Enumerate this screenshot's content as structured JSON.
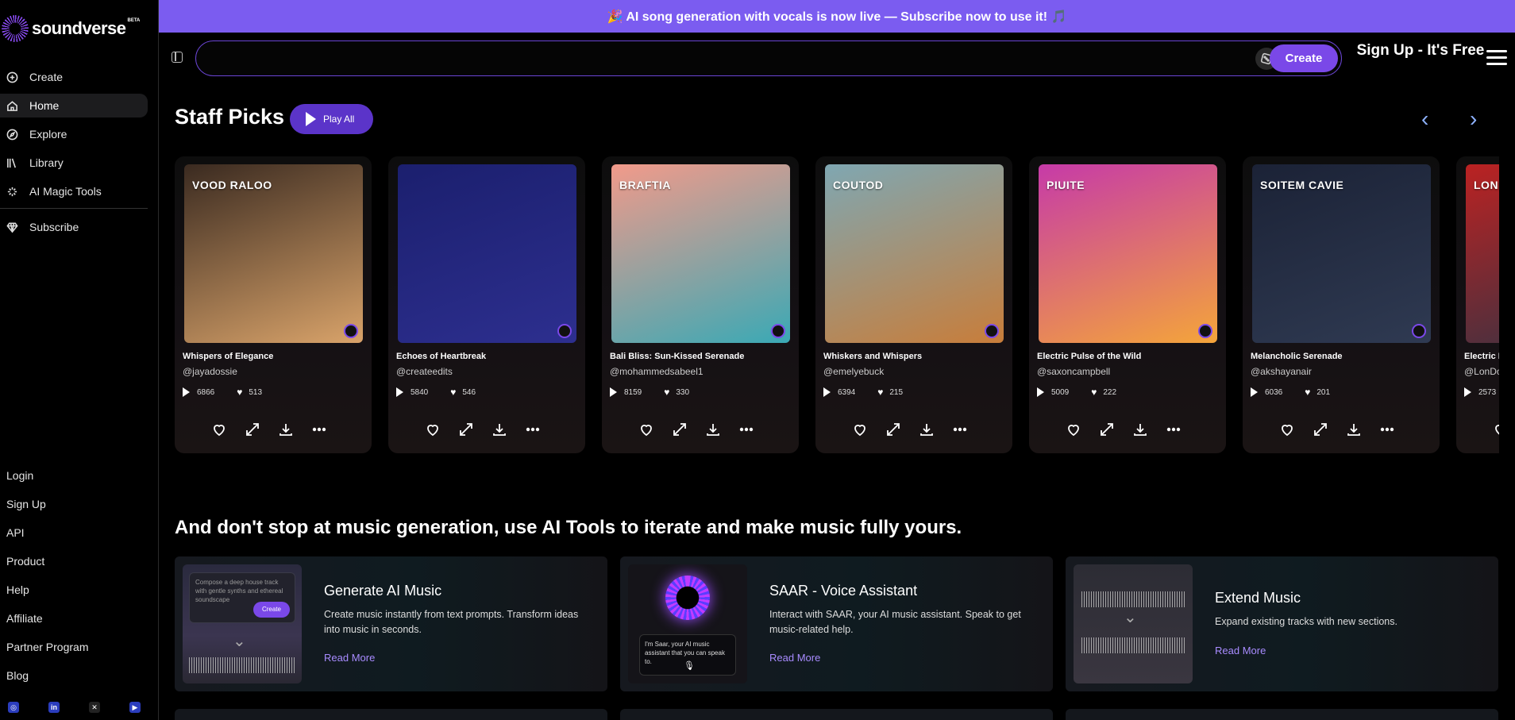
{
  "brand": {
    "name": "soundverse",
    "badge": "BETA"
  },
  "banner": {
    "text": "🎉 AI song generation with vocals is now live — Subscribe now to use it! 🎵"
  },
  "sidebar": {
    "items": [
      {
        "label": "Create",
        "icon": "plus-circle-icon"
      },
      {
        "label": "Home",
        "icon": "home-icon",
        "active": true
      },
      {
        "label": "Explore",
        "icon": "compass-icon"
      },
      {
        "label": "Library",
        "icon": "library-icon"
      },
      {
        "label": "AI Magic Tools",
        "icon": "sparkles-icon"
      }
    ],
    "subscribe": {
      "label": "Subscribe",
      "icon": "gem-icon"
    },
    "links": [
      "Login",
      "Sign Up",
      "API",
      "Product",
      "Help",
      "Affiliate",
      "Partner Program",
      "Blog"
    ],
    "socials": [
      "instagram-icon",
      "linkedin-icon",
      "x-icon",
      "youtube-icon"
    ]
  },
  "topbar": {
    "search_value": "",
    "create_label": "Create",
    "signup_label": "Sign Up - It's Free"
  },
  "staff_picks": {
    "title": "Staff Picks",
    "play_all_label": "Play All",
    "cards": [
      {
        "song": "Whispers of Elegance",
        "user": "@jayadossie",
        "plays": "6866",
        "likes": "513",
        "art_text": "VOOD RALOO",
        "c1": "#3a2a20",
        "c2": "#d9a36a"
      },
      {
        "song": "Echoes of Heartbreak",
        "user": "@createedits",
        "plays": "5840",
        "likes": "546",
        "art_text": "",
        "c1": "#1b1f6e",
        "c2": "#2d2f8f"
      },
      {
        "song": "Bali Bliss: Sun-Kissed Serenade",
        "user": "@mohammedsabeel1",
        "plays": "8159",
        "likes": "330",
        "art_text": "BRAFTIA",
        "c1": "#f29a8a",
        "c2": "#3aa9b5"
      },
      {
        "song": "Whiskers and Whispers",
        "user": "@emelyebuck",
        "plays": "6394",
        "likes": "215",
        "art_text": "COUTOD",
        "c1": "#7fa7b2",
        "c2": "#c87d3a"
      },
      {
        "song": "Electric Pulse of the Wild",
        "user": "@saxoncampbell",
        "plays": "5009",
        "likes": "222",
        "art_text": "PIUITE",
        "c1": "#c63aa8",
        "c2": "#f4a53a"
      },
      {
        "song": "Melancholic Serenade",
        "user": "@akshayanair",
        "plays": "6036",
        "likes": "201",
        "art_text": "SOITEM CAVIE",
        "c1": "#1b2236",
        "c2": "#2f3a52"
      },
      {
        "song": "Electric B",
        "user": "@LonDo",
        "plays": "2573",
        "likes": "",
        "art_text": "LONDO",
        "c1": "#b22",
        "c2": "#334"
      }
    ]
  },
  "tools": {
    "title": "And don't stop at music generation, use AI Tools to iterate and make music fully yours.",
    "items": [
      {
        "title": "Generate AI Music",
        "desc": "Create music instantly from text prompts. Transform ideas into music in seconds.",
        "more": "Read More",
        "thumb_text": "Compose a deep house track with gentle synths and ethereal soundscape",
        "thumb_button": "Create"
      },
      {
        "title": "SAAR - Voice Assistant",
        "desc": "Interact with SAAR, your AI music assistant. Speak to get music-related help.",
        "more": "Read More",
        "thumb_text": "I'm Saar, your AI music assistant that you can speak to."
      },
      {
        "title": "Extend Music",
        "desc": "Expand existing tracks with new sections.",
        "more": "Read More"
      }
    ]
  }
}
